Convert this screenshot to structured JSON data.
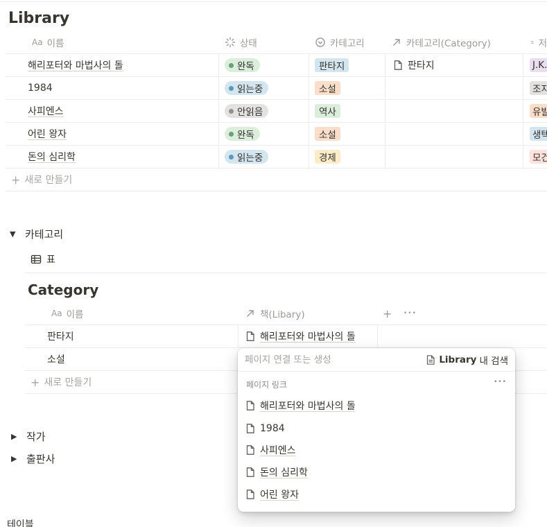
{
  "library": {
    "title": "Library",
    "columns": {
      "name": "이름",
      "status": "상태",
      "category": "카테고리",
      "category_rel": "카테고리(Category)",
      "author_partial": "저"
    },
    "rows": [
      {
        "name": "해리포터와 마법사의 돌",
        "status": "완독",
        "category": "판타지",
        "relation": "판타지",
        "author": "J.K."
      },
      {
        "name": "1984",
        "status": "읽는중",
        "category": "소설",
        "relation": "",
        "author": "조지"
      },
      {
        "name": "사피엔스",
        "status": "안읽음",
        "category": "역사",
        "relation": "",
        "author": "유발"
      },
      {
        "name": "어린 왕자",
        "status": "완독",
        "category": "소설",
        "relation": "",
        "author": "생텍"
      },
      {
        "name": "돈의 심리학",
        "status": "읽는중",
        "category": "경제",
        "relation": "",
        "author": "모건"
      }
    ],
    "new_label": "새로 만들기"
  },
  "colors": {
    "status_done_bg": "#dbeddb",
    "status_done_dot": "#6c9b7d",
    "status_reading_bg": "#d3e5ef",
    "status_reading_dot": "#5b97bd",
    "status_unread_bg": "#e3e2e0",
    "status_unread_dot": "#91918e",
    "tag_fantasy": "#d3e5ef",
    "tag_novel": "#fadec9",
    "tag_history": "#dbeddb",
    "tag_economy": "#fdecc8",
    "author_bg_1": "#e8deee",
    "author_bg_2": "#e3e2e0",
    "author_bg_3": "#fadec9",
    "author_bg_4": "#d3e5ef",
    "author_bg_5": "#ffe2dd"
  },
  "sections": {
    "category_toggle": "카테고리",
    "view_tab": "표",
    "author_toggle": "작가",
    "publisher_toggle": "출판사",
    "footer_text": "테이블"
  },
  "category_db": {
    "title": "Category",
    "columns": {
      "name": "이름",
      "books": "책(Libary)"
    },
    "rows": [
      {
        "name": "판타지",
        "books": "해리포터와 마법사의 돌"
      },
      {
        "name": "소설",
        "books": ""
      }
    ],
    "new_label": "새로 만들기"
  },
  "popup": {
    "search_placeholder": "페이지 연결 또는 생성",
    "scope_db": "Library",
    "scope_suffix": "내 검색",
    "section_label": "페이지 링크",
    "items": [
      "해리포터와 마법사의 돌",
      "1984",
      "사피엔스",
      "돈의 심리학",
      "어린 왕자"
    ]
  },
  "icons": {
    "name_prop": "Aa",
    "more": "•••",
    "add": "+"
  }
}
